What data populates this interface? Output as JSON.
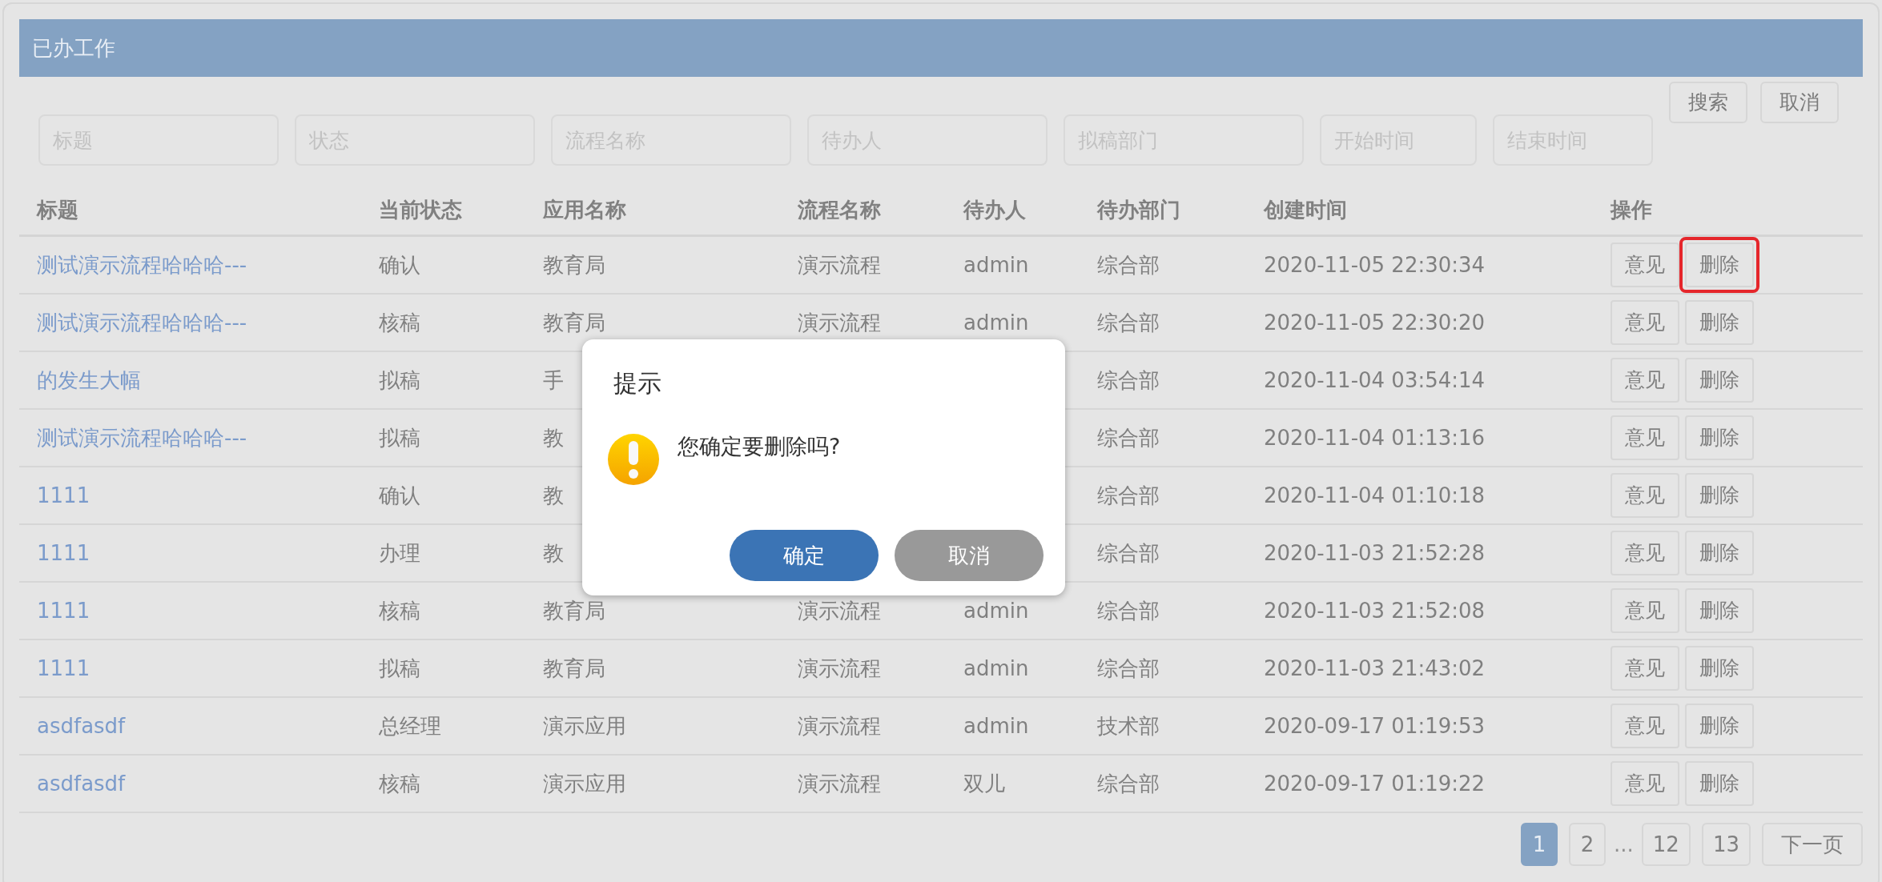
{
  "panel": {
    "title": "已办工作"
  },
  "filters": [
    {
      "placeholder": "标题"
    },
    {
      "placeholder": "状态"
    },
    {
      "placeholder": "流程名称"
    },
    {
      "placeholder": "待办人"
    },
    {
      "placeholder": "拟稿部门"
    },
    {
      "placeholder": "开始时间"
    },
    {
      "placeholder": "结束时间"
    }
  ],
  "filter_buttons": [
    "搜索",
    "取消"
  ],
  "table": {
    "columns": [
      "标题",
      "当前状态",
      "应用名称",
      "流程名称",
      "待办人",
      "待办部门",
      "创建时间",
      "操作"
    ],
    "rows": [
      {
        "title": "测试演示流程哈哈哈---",
        "status": "确认",
        "app": "教育局",
        "flow": "演示流程",
        "assignee": "admin",
        "dept": "综合部",
        "created": "2020-11-05 22:30:34",
        "actions": [
          "意见",
          "删除"
        ],
        "delete_highlighted": true
      },
      {
        "title": "测试演示流程哈哈哈---",
        "status": "核稿",
        "app": "教育局",
        "flow": "演示流程",
        "assignee": "admin",
        "dept": "综合部",
        "created": "2020-11-05 22:30:20",
        "actions": [
          "意见",
          "删除"
        ],
        "delete_highlighted": false
      },
      {
        "title": "的发生大幅",
        "status": "拟稿",
        "app": "手",
        "dept": "综合部",
        "created": "2020-11-04 03:54:14",
        "actions": [
          "意见",
          "删除"
        ],
        "delete_highlighted": false
      },
      {
        "title": "测试演示流程哈哈哈---",
        "status": "拟稿",
        "app": "教",
        "dept": "综合部",
        "created": "2020-11-04 01:13:16",
        "actions": [
          "意见",
          "删除"
        ],
        "delete_highlighted": false
      },
      {
        "title": "1111",
        "status": "确认",
        "app": "教",
        "dept": "综合部",
        "created": "2020-11-04 01:10:18",
        "actions": [
          "意见",
          "删除"
        ],
        "delete_highlighted": false
      },
      {
        "title": "1111",
        "status": "办理",
        "app": "教",
        "dept": "综合部",
        "created": "2020-11-03 21:52:28",
        "actions": [
          "意见",
          "删除"
        ],
        "delete_highlighted": false
      },
      {
        "title": "1111",
        "status": "核稿",
        "app": "教育局",
        "flow": "演示流程",
        "assignee": "admin",
        "dept": "综合部",
        "created": "2020-11-03 21:52:08",
        "actions": [
          "意见",
          "删除"
        ],
        "delete_highlighted": false
      },
      {
        "title": "1111",
        "status": "拟稿",
        "app": "教育局",
        "flow": "演示流程",
        "assignee": "admin",
        "dept": "综合部",
        "created": "2020-11-03 21:43:02",
        "actions": [
          "意见",
          "删除"
        ],
        "delete_highlighted": false
      },
      {
        "title": "asdfasdf",
        "status": "总经理",
        "app": "演示应用",
        "flow": "演示流程",
        "assignee": "admin",
        "dept": "技术部",
        "created": "2020-09-17 01:19:53",
        "actions": [
          "意见",
          "删除"
        ],
        "delete_highlighted": false
      },
      {
        "title": "asdfasdf",
        "status": "核稿",
        "app": "演示应用",
        "flow": "演示流程",
        "assignee": "双儿",
        "dept": "综合部",
        "created": "2020-09-17 01:19:22",
        "actions": [
          "意见",
          "删除"
        ],
        "delete_highlighted": false
      }
    ]
  },
  "pagination": [
    {
      "label": "1",
      "kind": "page",
      "selected": true
    },
    {
      "label": "2",
      "kind": "page",
      "selected": false
    },
    {
      "label": "...",
      "kind": "gap"
    },
    {
      "label": "12",
      "kind": "page",
      "selected": false
    },
    {
      "label": "13",
      "kind": "page",
      "selected": false
    },
    {
      "label": "下一页",
      "kind": "next"
    }
  ],
  "dialog": {
    "title": "提示",
    "message": "您确定要删除吗?",
    "buttons": [
      {
        "label": "确定",
        "kind": "primary"
      },
      {
        "label": "取消",
        "kind": "secondary"
      }
    ]
  }
}
